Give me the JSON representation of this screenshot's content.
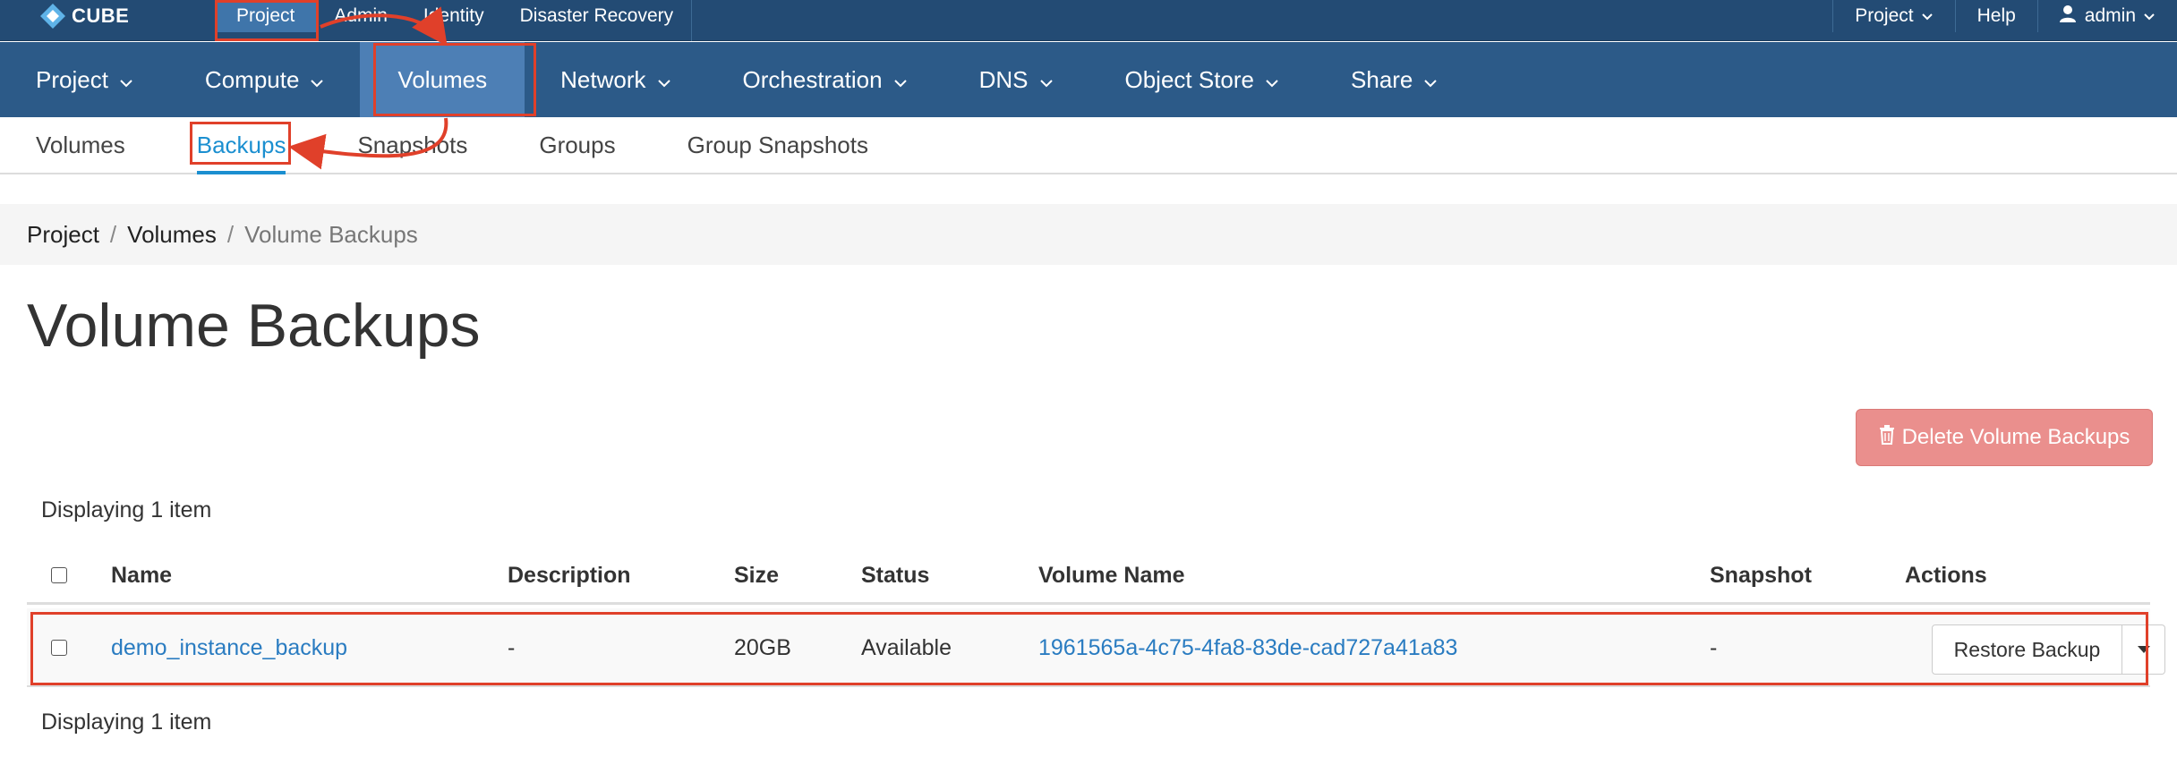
{
  "brand": {
    "name": "CUBE"
  },
  "top_nav": {
    "items": [
      "Project",
      "Admin",
      "Identity",
      "Disaster Recovery"
    ]
  },
  "top_right": {
    "project": "Project",
    "help": "Help",
    "user": "admin"
  },
  "main_nav": {
    "items": [
      "Project",
      "Compute",
      "Volumes",
      "Network",
      "Orchestration",
      "DNS",
      "Object Store",
      "Share"
    ]
  },
  "sub_nav": {
    "tabs": [
      "Volumes",
      "Backups",
      "Snapshots",
      "Groups",
      "Group Snapshots"
    ]
  },
  "breadcrumb": {
    "items": [
      "Project",
      "Volumes",
      "Volume Backups"
    ],
    "separator": "/"
  },
  "page": {
    "title": "Volume Backups",
    "delete_button": "Delete Volume Backups",
    "count_text": "Displaying 1 item"
  },
  "table": {
    "headers": {
      "name": "Name",
      "description": "Description",
      "size": "Size",
      "status": "Status",
      "volume_name": "Volume Name",
      "snapshot": "Snapshot",
      "actions": "Actions"
    },
    "rows": [
      {
        "name": "demo_instance_backup",
        "description": "-",
        "size": "20GB",
        "status": "Available",
        "volume_name": "1961565a-4c75-4fa8-83de-cad727a41a83",
        "snapshot": "-",
        "action": "Restore Backup"
      }
    ]
  },
  "colors": {
    "topbar": "#234b74",
    "mainnav": "#2c5a88",
    "active_nav": "#4d7fb5",
    "link": "#2a7cc1",
    "annotation": "#e0402a",
    "danger": "#e98a87"
  },
  "icons": {
    "brand": "cube-logo-icon",
    "user": "user-icon",
    "trash": "trash-icon",
    "caret": "chevron-down-icon"
  }
}
